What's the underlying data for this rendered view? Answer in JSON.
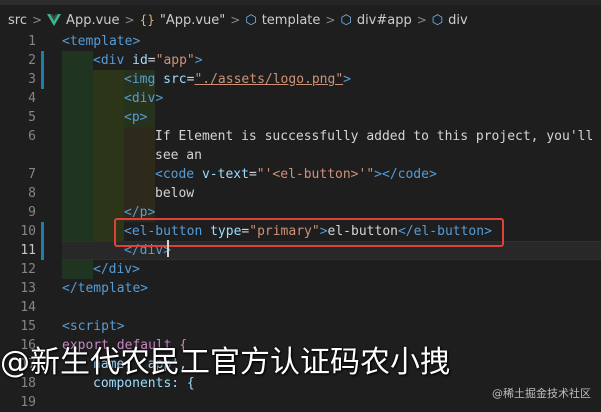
{
  "breadcrumb": {
    "root": "src",
    "file": "App.vue",
    "component": "\"App.vue\"",
    "template": "template",
    "div_app": "div#app",
    "div": "div",
    "separator": ">"
  },
  "colors": {
    "tag": "#569cd6",
    "attribute": "#9cdcfe",
    "string": "#ce9178",
    "text": "#d4d4d4",
    "highlight_box": "#e0403a",
    "vue_green": "#41b883"
  },
  "editor": {
    "line_numbers": [
      "1",
      "2",
      "3",
      "4",
      "5",
      "6",
      "",
      "7",
      "8",
      "9",
      "10",
      "11",
      "12",
      "13",
      "14",
      "15",
      "16",
      "17",
      "18",
      "19"
    ],
    "active_line": "11",
    "lines": {
      "l1": {
        "open": "<",
        "name": "template",
        "close": ">"
      },
      "l2": {
        "open": "<",
        "name": "div",
        "attr": "id",
        "eq": "=",
        "value": "\"app\"",
        "close": ">"
      },
      "l3": {
        "open": "<",
        "name": "img",
        "attr": "src",
        "eq": "=",
        "value": "\"./assets/logo.png\"",
        "close": ">"
      },
      "l4": {
        "open": "<",
        "name": "div",
        "close": ">"
      },
      "l5": {
        "open": "<",
        "name": "p",
        "close": ">"
      },
      "l6a": "If Element is successfully added to this project, you'll",
      "l6b": "see an",
      "l7": {
        "open": "<",
        "name": "code",
        "attr": "v-text",
        "eq": "=",
        "value": "\"'<el-button>'\"",
        "close": "></",
        "end_name": "code",
        "end_close": ">"
      },
      "l8": "below",
      "l9": {
        "open": "</",
        "name": "p",
        "close": ">"
      },
      "l10": {
        "open": "<",
        "name": "el-button",
        "attr": "type",
        "eq": "=",
        "value": "\"primary\"",
        "close": ">",
        "content": "el-button",
        "end_open": "</",
        "end_name": "el-button",
        "end_close": ">"
      },
      "l11": {
        "open": "</",
        "name": "div",
        "close": ">"
      },
      "l12": {
        "open": "</",
        "name": "div",
        "close": ">"
      },
      "l13": {
        "open": "</",
        "name": "template",
        "close": ">"
      },
      "l15": {
        "open": "<",
        "name": "script",
        "close": ">"
      },
      "l16": "export default {",
      "l17": "name: 'app',",
      "l18": "components: {"
    }
  },
  "watermark": {
    "main": "@新生代农民工官方认证码农小拽",
    "small": "@稀土掘金技术社区"
  }
}
